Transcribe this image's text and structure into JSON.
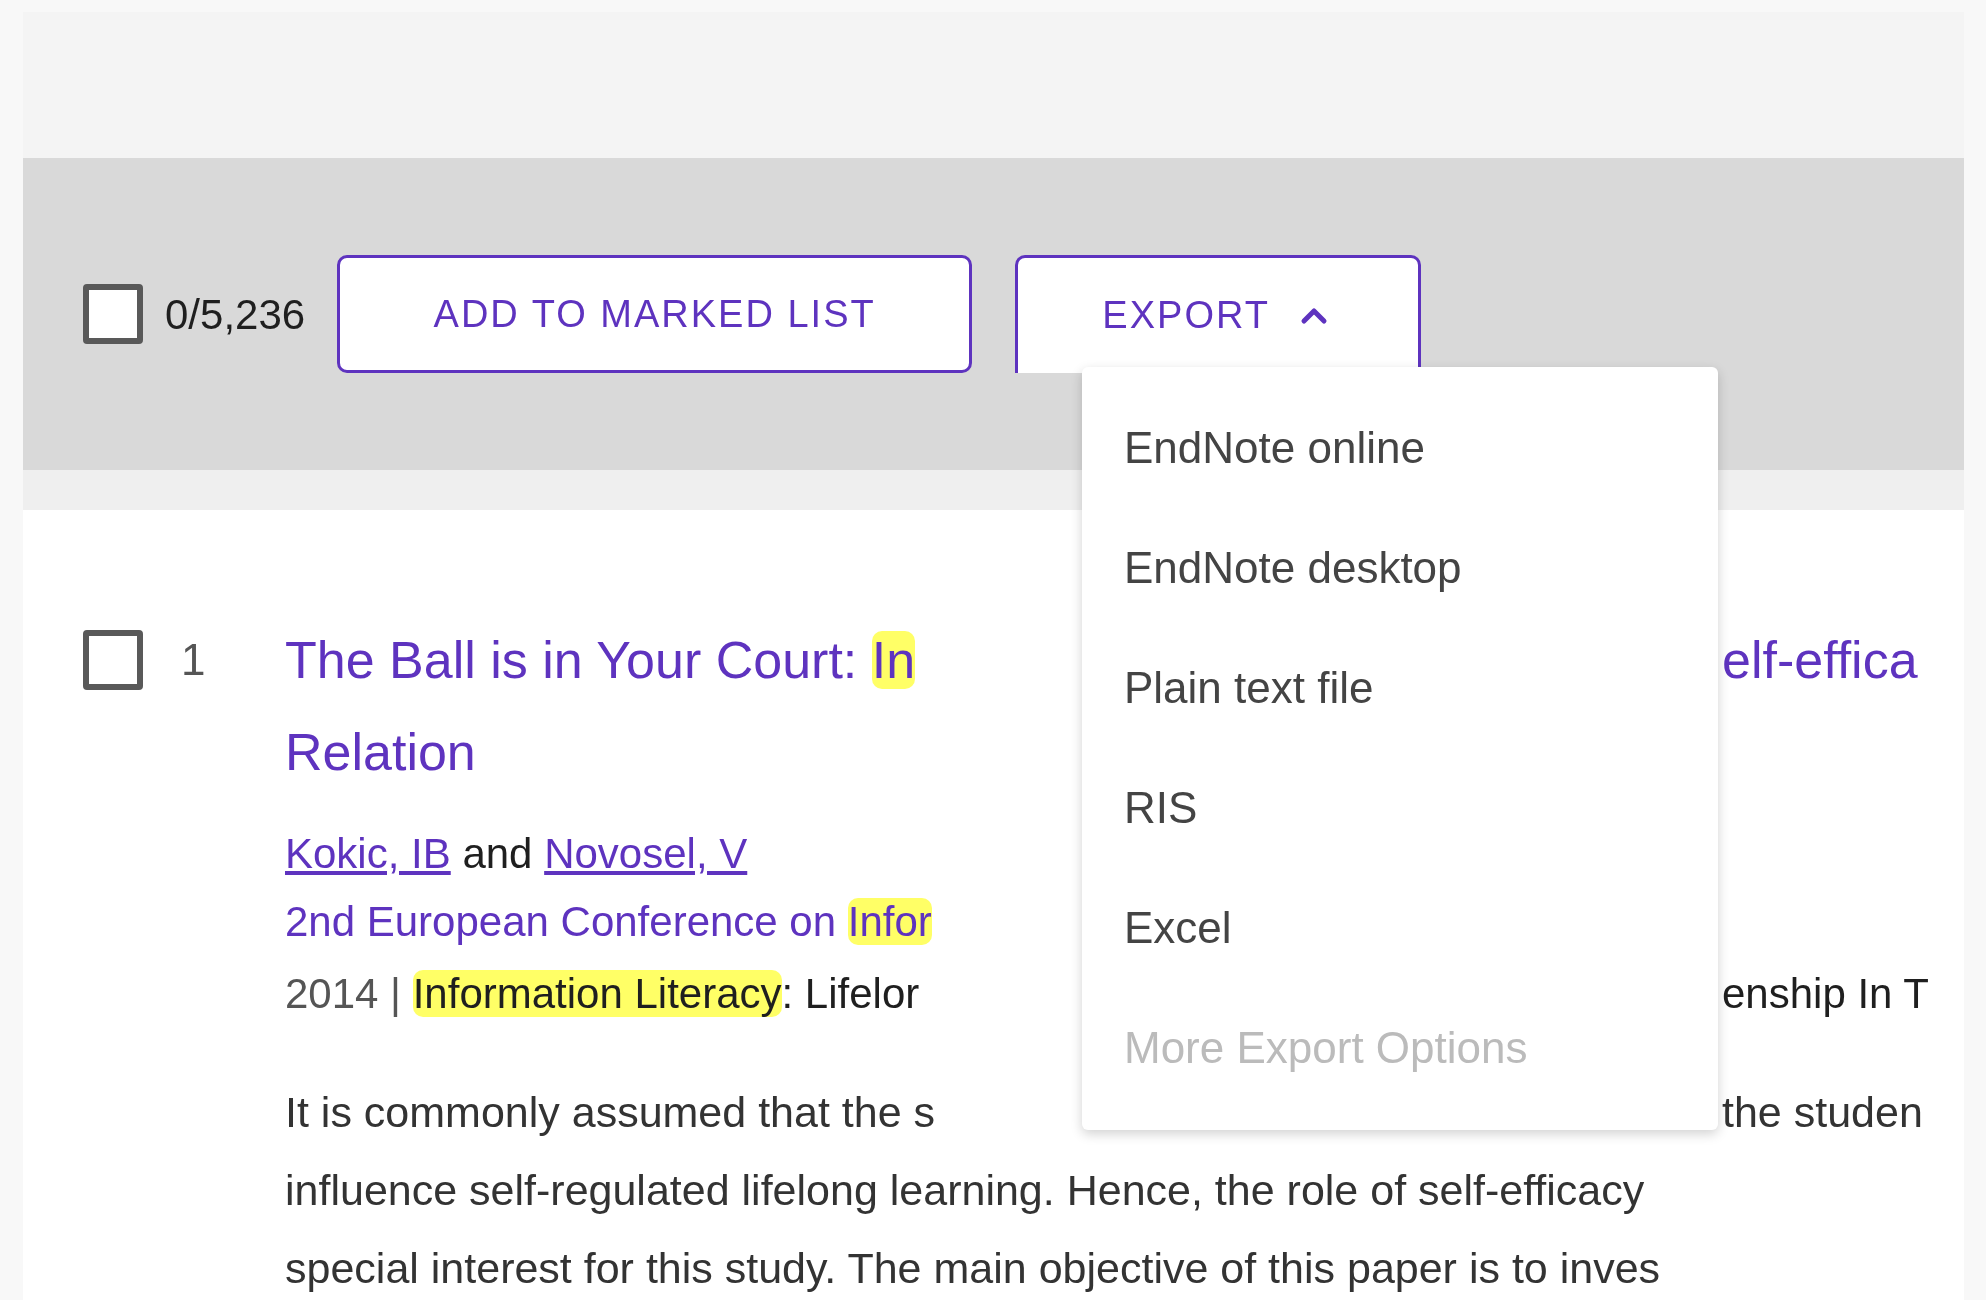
{
  "toolbar": {
    "select_all": {
      "checked": false
    },
    "count": "0/5,236",
    "buttons": [
      {
        "label": "ADD TO MARKED LIST",
        "kind": "plain",
        "expanded": false
      },
      {
        "label": "EXPORT",
        "kind": "dropdown",
        "expanded": true
      }
    ]
  },
  "export_menu": {
    "items": [
      {
        "label": "EndNote online",
        "disabled": false
      },
      {
        "label": "EndNote desktop",
        "disabled": false
      },
      {
        "label": "Plain text file",
        "disabled": false
      },
      {
        "label": "RIS",
        "disabled": false
      },
      {
        "label": "Excel",
        "disabled": false
      },
      {
        "label": "More Export Options",
        "disabled": true
      }
    ]
  },
  "results": [
    {
      "checked": false,
      "number": "1",
      "lines": [
        {
          "kind": "title",
          "left": [
            {
              "text": "The Ball is in Your Court: ",
              "highlight": false,
              "link": false,
              "muted": false
            },
            {
              "text": "In",
              "highlight": true,
              "link": false,
              "muted": false
            }
          ],
          "right": [
            {
              "text": "elf-effica",
              "highlight": false,
              "link": false,
              "muted": false
            }
          ]
        },
        {
          "kind": "title",
          "left": [
            {
              "text": "Relation",
              "highlight": false,
              "link": false,
              "muted": false
            }
          ]
        },
        {
          "kind": "authors",
          "left": [
            {
              "text": "Kokic, IB",
              "highlight": false,
              "link": true,
              "muted": false
            },
            {
              "text": " and ",
              "highlight": false,
              "link": false,
              "muted": false
            },
            {
              "text": "Novosel, V",
              "highlight": false,
              "link": true,
              "muted": false
            }
          ]
        },
        {
          "kind": "source_title",
          "left": [
            {
              "text": "2nd European Conference on ",
              "highlight": false,
              "link": false,
              "muted": false
            },
            {
              "text": "Infor",
              "highlight": true,
              "link": false,
              "muted": false
            }
          ]
        },
        {
          "kind": "source",
          "left": [
            {
              "text": "2014 | ",
              "highlight": false,
              "link": false,
              "muted": true
            },
            {
              "text": "Information Literacy",
              "highlight": true,
              "link": false,
              "muted": false
            },
            {
              "text": ": Lifelor",
              "highlight": false,
              "link": false,
              "muted": false
            }
          ],
          "right": [
            {
              "text": "enship In T",
              "highlight": false,
              "link": false,
              "muted": false
            }
          ]
        },
        {
          "kind": "abstract",
          "left": [
            {
              "text": "It is commonly assumed that the s",
              "highlight": false,
              "link": false,
              "muted": false
            }
          ],
          "right": [
            {
              "text": "the studen",
              "highlight": false,
              "link": false,
              "muted": false
            }
          ]
        },
        {
          "kind": "abstract",
          "left": [
            {
              "text": "influence self-regulated lifelong learning. Hence, the role of self-efficacy",
              "highlight": false,
              "link": false,
              "muted": false
            }
          ]
        },
        {
          "kind": "abstract",
          "left": [
            {
              "text": "special interest for this study. The main objective of this paper is to inves",
              "highlight": false,
              "link": false,
              "muted": false
            }
          ]
        }
      ]
    }
  ]
}
